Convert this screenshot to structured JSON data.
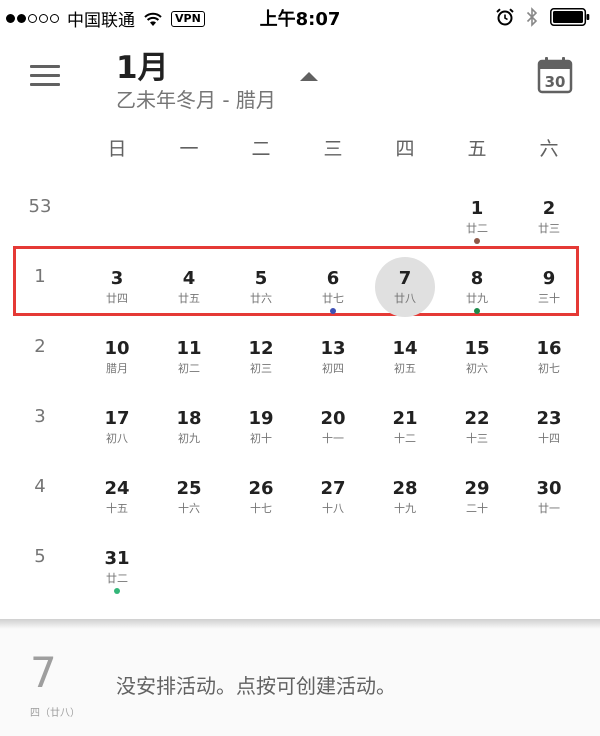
{
  "status_bar": {
    "carrier": "中国联通",
    "vpn": "VPN",
    "time": "上午8:07"
  },
  "header": {
    "month": "1月",
    "lunar": "乙未年冬月 - 腊月",
    "today_icon_day": "30"
  },
  "weekdays": [
    "日",
    "一",
    "二",
    "三",
    "四",
    "五",
    "六"
  ],
  "weeks": [
    {
      "week_no": "53",
      "days": [
        null,
        null,
        null,
        null,
        null,
        {
          "date": "1",
          "lunar": "廿二",
          "dot": "#8d5a4a"
        },
        {
          "date": "2",
          "lunar": "廿三"
        }
      ]
    },
    {
      "week_no": "1",
      "selected": true,
      "days": [
        {
          "date": "3",
          "lunar": "廿四"
        },
        {
          "date": "4",
          "lunar": "廿五"
        },
        {
          "date": "5",
          "lunar": "廿六"
        },
        {
          "date": "6",
          "lunar": "廿七",
          "dot": "#3f51b5"
        },
        {
          "date": "7",
          "lunar": "廿八",
          "today": true
        },
        {
          "date": "8",
          "lunar": "廿九",
          "dot": "#1b8a4a"
        },
        {
          "date": "9",
          "lunar": "三十"
        }
      ]
    },
    {
      "week_no": "2",
      "days": [
        {
          "date": "10",
          "lunar": "腊月"
        },
        {
          "date": "11",
          "lunar": "初二"
        },
        {
          "date": "12",
          "lunar": "初三"
        },
        {
          "date": "13",
          "lunar": "初四"
        },
        {
          "date": "14",
          "lunar": "初五"
        },
        {
          "date": "15",
          "lunar": "初六"
        },
        {
          "date": "16",
          "lunar": "初七"
        }
      ]
    },
    {
      "week_no": "3",
      "days": [
        {
          "date": "17",
          "lunar": "初八"
        },
        {
          "date": "18",
          "lunar": "初九"
        },
        {
          "date": "19",
          "lunar": "初十"
        },
        {
          "date": "20",
          "lunar": "十一"
        },
        {
          "date": "21",
          "lunar": "十二"
        },
        {
          "date": "22",
          "lunar": "十三"
        },
        {
          "date": "23",
          "lunar": "十四"
        }
      ]
    },
    {
      "week_no": "4",
      "days": [
        {
          "date": "24",
          "lunar": "十五"
        },
        {
          "date": "25",
          "lunar": "十六"
        },
        {
          "date": "26",
          "lunar": "十七"
        },
        {
          "date": "27",
          "lunar": "十八"
        },
        {
          "date": "28",
          "lunar": "十九"
        },
        {
          "date": "29",
          "lunar": "二十"
        },
        {
          "date": "30",
          "lunar": "廿一"
        }
      ]
    },
    {
      "week_no": "5",
      "days": [
        {
          "date": "31",
          "lunar": "廿二",
          "dot": "#33b679"
        },
        null,
        null,
        null,
        null,
        null,
        null
      ]
    }
  ],
  "agenda": {
    "day": "7",
    "weekday_lunar": "四（廿八）",
    "empty_text": "没安排活动。点按可创建活动。"
  }
}
